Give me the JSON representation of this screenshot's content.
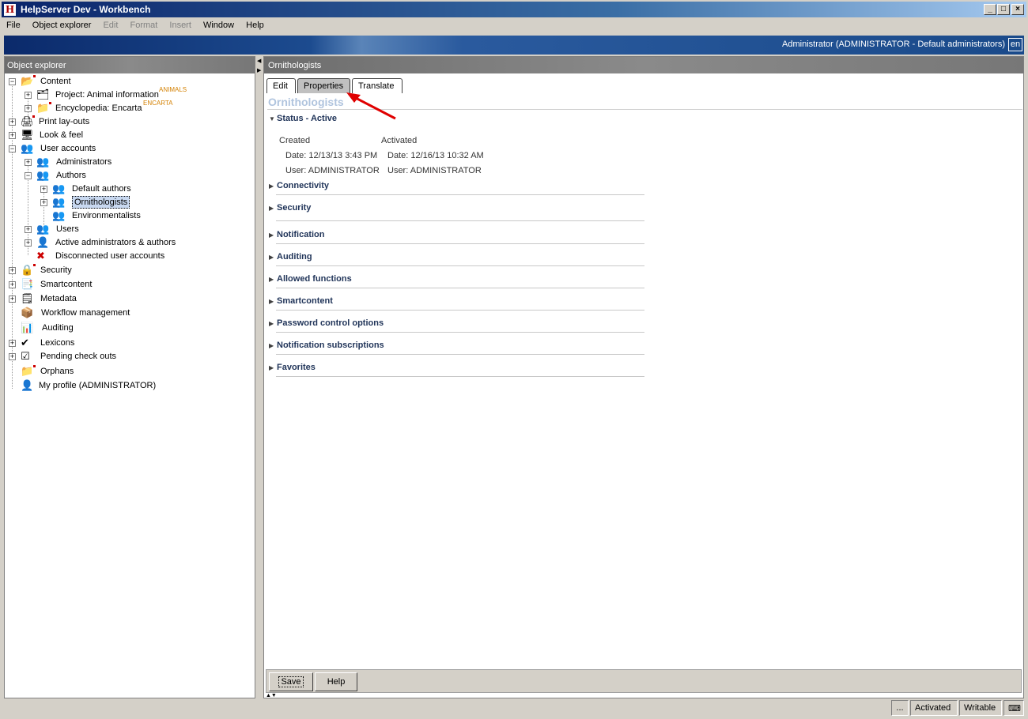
{
  "window": {
    "title": "HelpServer Dev - Workbench",
    "app_icon": "H"
  },
  "menu": {
    "items": [
      {
        "label": "File",
        "enabled": true
      },
      {
        "label": "Object explorer",
        "enabled": true
      },
      {
        "label": "Edit",
        "enabled": false
      },
      {
        "label": "Format",
        "enabled": false
      },
      {
        "label": "Insert",
        "enabled": false
      },
      {
        "label": "Window",
        "enabled": true
      },
      {
        "label": "Help",
        "enabled": true
      }
    ]
  },
  "banner": {
    "user": "Administrator (ADMINISTRATOR - Default administrators)",
    "lang": "en"
  },
  "explorer": {
    "header": "Object explorer",
    "nodes": {
      "content": "Content",
      "project": "Project: Animal information",
      "project_tag": "ANIMALS",
      "encyclopedia": "Encyclopedia: Encarta",
      "encyclopedia_tag": "ENCARTA",
      "print_layouts": "Print lay-outs",
      "look_feel": "Look & feel",
      "user_accounts": "User accounts",
      "administrators": "Administrators",
      "authors": "Authors",
      "default_authors": "Default authors",
      "ornithologists": "Ornithologists",
      "environmentalists": "Environmentalists",
      "users": "Users",
      "active_admins": "Active administrators & authors",
      "disconnected": "Disconnected user accounts",
      "security": "Security",
      "smartcontent": "Smartcontent",
      "metadata": "Metadata",
      "workflow": "Workflow management",
      "auditing": "Auditing",
      "lexicons": "Lexicons",
      "pending": "Pending check outs",
      "orphans": "Orphans",
      "my_profile": "My profile (ADMINISTRATOR)"
    }
  },
  "detail": {
    "header": "Ornithologists",
    "tabs": [
      "Edit",
      "Properties",
      "Translate"
    ],
    "active_tab": "Properties",
    "object_title": "Ornithologists",
    "status": {
      "section_label": "Status - Active",
      "created_label": "Created",
      "activated_label": "Activated",
      "created_date": "Date:  12/13/13 3:43 PM",
      "created_user": "User:  ADMINISTRATOR",
      "activated_date": "Date:  12/16/13 10:32 AM",
      "activated_user": "User:  ADMINISTRATOR"
    },
    "sections": [
      "Connectivity",
      "Security",
      "Notification",
      "Auditing",
      "Allowed functions",
      "Smartcontent",
      "Password control options",
      "Notification subscriptions",
      "Favorites"
    ],
    "buttons": {
      "save": "Save",
      "help": "Help"
    }
  },
  "statusbar": {
    "more": "...",
    "state": "Activated",
    "mode": "Writable"
  },
  "colors": {
    "annotation_arrow": "#e00000",
    "section_text": "#1f3358",
    "object_title": "#b0c4de"
  }
}
